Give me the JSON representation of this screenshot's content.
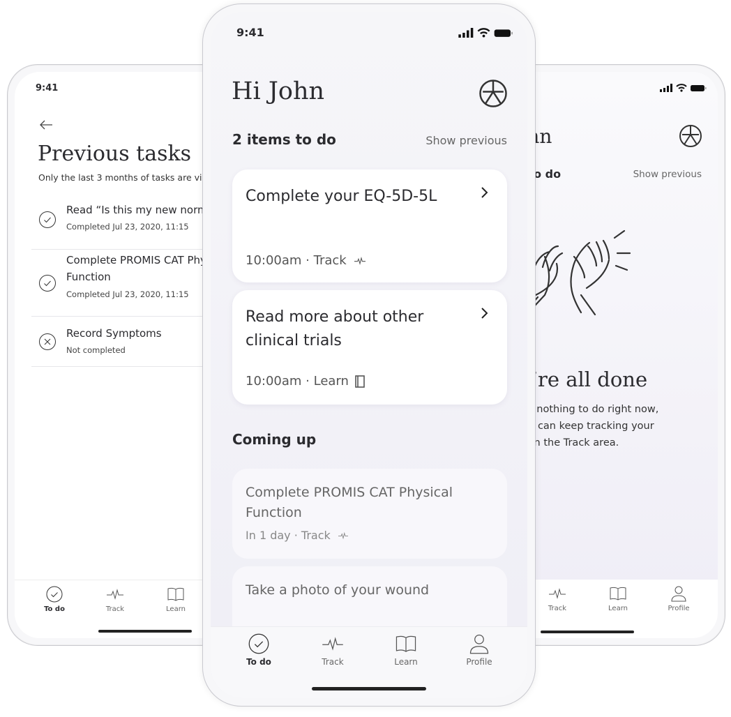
{
  "status_time": "9:41",
  "left_phone": {
    "title": "Previous tasks",
    "subtitle": "Only the last 3 months of tasks are visible",
    "tasks": [
      {
        "title": "Read “Is this my new normal”",
        "status": "Completed Jul 23, 2020, 11:15",
        "icon": "check-circle-icon"
      },
      {
        "title_line1": "Complete PROMIS CAT Physical",
        "title_line2": "Function",
        "status": "Completed Jul 23, 2020, 11:15",
        "icon": "check-circle-icon"
      },
      {
        "title": "Record Symptoms",
        "status": "Not completed",
        "icon": "x-circle-icon"
      }
    ]
  },
  "center_phone": {
    "greeting": "Hi John",
    "todo_header": "2 items to do",
    "show_previous": "Show previous",
    "todo_cards": [
      {
        "title": "Complete your EQ-5D-5L",
        "meta": "10:00am · Track",
        "icon": "pulse-icon"
      },
      {
        "title": "Read more about other clinical trials",
        "meta": "10:00am · Learn",
        "icon": "document-icon"
      }
    ],
    "coming_up_header": "Coming up",
    "coming_up_cards": [
      {
        "title": "Complete PROMIS CAT Physical Function",
        "meta": "In 1 day · Track",
        "icon": "pulse-icon"
      },
      {
        "title": "Take a photo of your wound"
      }
    ]
  },
  "right_phone": {
    "greeting": "Hi John",
    "todo_header": "0 items to do",
    "show_previous": "Show previous",
    "done_title": "You’re all done",
    "done_text": "There’s nothing to do right now, but you can keep tracking your health in the Track area."
  },
  "tabs": {
    "todo": "To do",
    "track": "Track",
    "learn": "Learn",
    "profile": "Profile"
  }
}
